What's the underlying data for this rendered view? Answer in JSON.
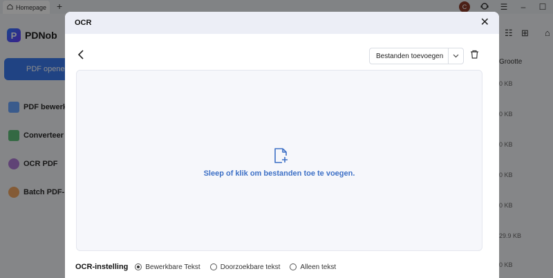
{
  "window": {
    "tab_label": "Homepage",
    "avatar_letter": "C"
  },
  "app": {
    "brand_name": "PDNob",
    "open_button": "PDF openen",
    "nav": [
      {
        "label": "PDF bewerken",
        "icon": "edit-pdf-icon"
      },
      {
        "label": "Converteer PDF",
        "icon": "convert-icon"
      },
      {
        "label": "OCR PDF",
        "icon": "ocr-icon"
      },
      {
        "label": "Batch PDF-bewerking",
        "icon": "batch-icon"
      }
    ],
    "column_header": "Grootte",
    "sizes": [
      "0 KB",
      "0 KB",
      "0 KB",
      "0 KB",
      "0 KB",
      "29.9 KB",
      "0 KB"
    ]
  },
  "modal": {
    "title": "OCR",
    "add_files_label": "Bestanden toevoegen",
    "dropzone_text": "Sleep of klik om bestanden toe te voegen.",
    "settings_label": "OCR-instelling",
    "options": [
      {
        "label": "Bewerkbare Tekst",
        "selected": true
      },
      {
        "label": "Doorzoekbare tekst",
        "selected": false
      },
      {
        "label": "Alleen tekst",
        "selected": false
      }
    ]
  },
  "colors": {
    "accent": "#3b7bef",
    "link_text": "#3d70c6"
  }
}
